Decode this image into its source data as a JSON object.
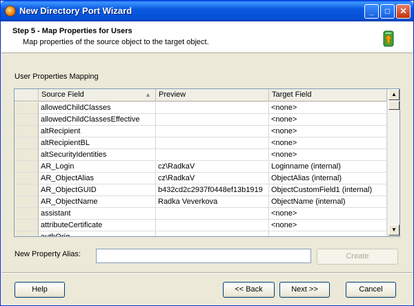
{
  "window": {
    "title": "New Directory Port Wizard",
    "minimize_label": "_",
    "maximize_label": "□",
    "close_label": "✕"
  },
  "header": {
    "step_title": "Step 5 - Map Properties for Users",
    "step_description": "Map properties of the source object to the target object."
  },
  "section": {
    "label": "User Properties Mapping"
  },
  "grid": {
    "columns": [
      "Source Field",
      "Preview",
      "Target Field"
    ],
    "rows": [
      {
        "source": "allowedChildClasses",
        "preview": "",
        "target": "<none>"
      },
      {
        "source": "allowedChildClassesEffective",
        "preview": "",
        "target": "<none>"
      },
      {
        "source": "altRecipient",
        "preview": "",
        "target": "<none>"
      },
      {
        "source": "altRecipientBL",
        "preview": "",
        "target": "<none>"
      },
      {
        "source": "altSecurityIdentities",
        "preview": "",
        "target": "<none>"
      },
      {
        "source": "AR_Login",
        "preview": "cz\\RadkaV",
        "target": "Loginname (internal)"
      },
      {
        "source": "AR_ObjectAlias",
        "preview": "cz\\RadkaV",
        "target": "ObjectAlias (internal)"
      },
      {
        "source": "AR_ObjectGUID",
        "preview": "b432cd2c2937f0448ef13b1919",
        "target": "ObjectCustomField1  (internal)"
      },
      {
        "source": "AR_ObjectName",
        "preview": "Radka Veverkova",
        "target": "ObjectName (internal)"
      },
      {
        "source": "assistant",
        "preview": "",
        "target": "<none>"
      },
      {
        "source": "attributeCertificate",
        "preview": "",
        "target": "<none>"
      },
      {
        "source": "authOrig",
        "preview": "",
        "target": ""
      }
    ]
  },
  "alias": {
    "label": "New Property Alias:",
    "value": "",
    "create_label": "Create"
  },
  "footer": {
    "help_label": "Help",
    "back_label": "<< Back",
    "next_label": "Next >>",
    "cancel_label": "Cancel"
  }
}
